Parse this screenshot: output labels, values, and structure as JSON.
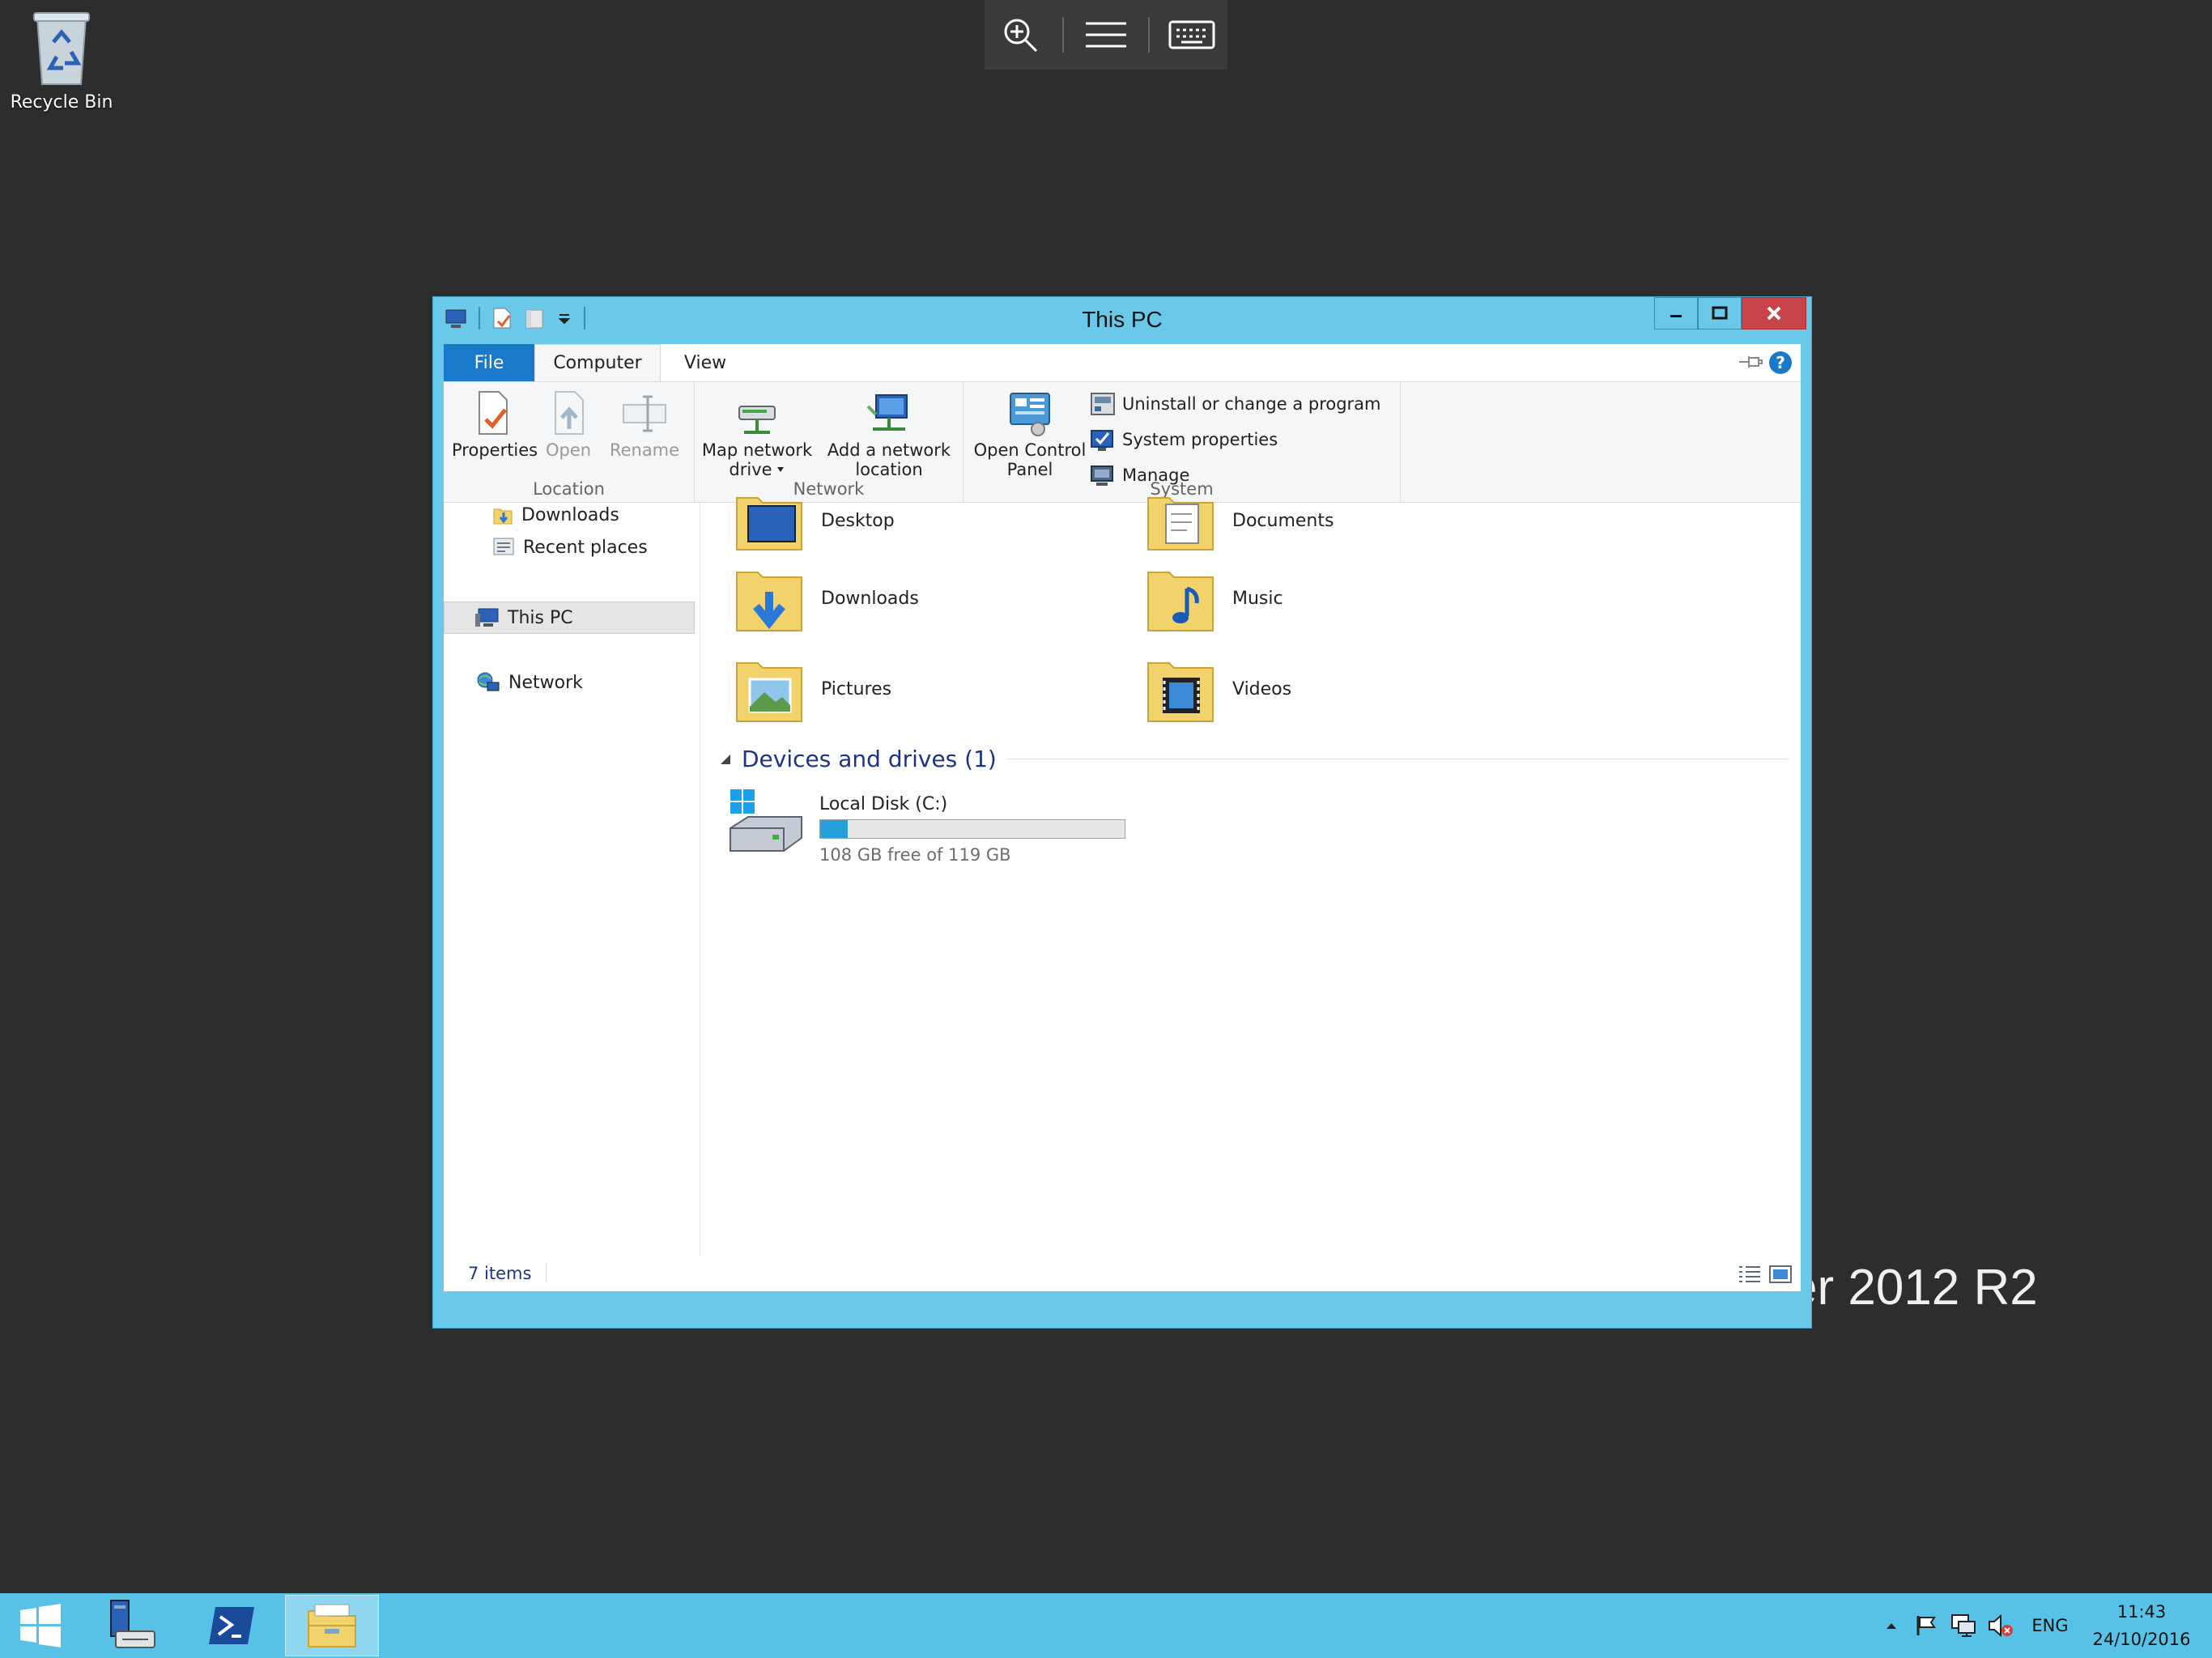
{
  "desktop": {
    "recycle_bin_label": "Recycle Bin",
    "watermark_text": "er 2012 R2"
  },
  "remote_toolbar": {
    "icons": [
      "zoom-icon",
      "menu-icon",
      "keyboard-icon"
    ]
  },
  "window": {
    "title": "This PC",
    "tabs": {
      "file": "File",
      "computer": "Computer",
      "view": "View"
    },
    "ribbon": {
      "location": {
        "label": "Location",
        "properties": "Properties",
        "open": "Open",
        "rename": "Rename"
      },
      "network": {
        "label": "Network",
        "map_drive_line1": "Map network",
        "map_drive_line2": "drive",
        "add_location_line1": "Add a network",
        "add_location_line2": "location"
      },
      "system": {
        "label": "System",
        "control_panel_line1": "Open Control",
        "control_panel_line2": "Panel",
        "uninstall": "Uninstall or change a program",
        "system_properties": "System properties",
        "manage": "Manage"
      }
    },
    "nav": {
      "downloads": "Downloads",
      "recent": "Recent places",
      "this_pc": "This PC",
      "network": "Network"
    },
    "folders": {
      "desktop": "Desktop",
      "documents": "Documents",
      "downloads": "Downloads",
      "music": "Music",
      "pictures": "Pictures",
      "videos": "Videos"
    },
    "devices_section": "Devices and drives (1)",
    "drive": {
      "name": "Local Disk (C:)",
      "free_text": "108 GB free of 119 GB",
      "used_fraction": 0.09
    },
    "status": "7 items"
  },
  "taskbar": {
    "lang": "ENG",
    "time": "11:43",
    "date": "24/10/2016"
  },
  "colors": {
    "accent": "#1979ca",
    "frame": "#6ac9e8",
    "taskbar": "#58c2e6",
    "close": "#c7444a"
  }
}
